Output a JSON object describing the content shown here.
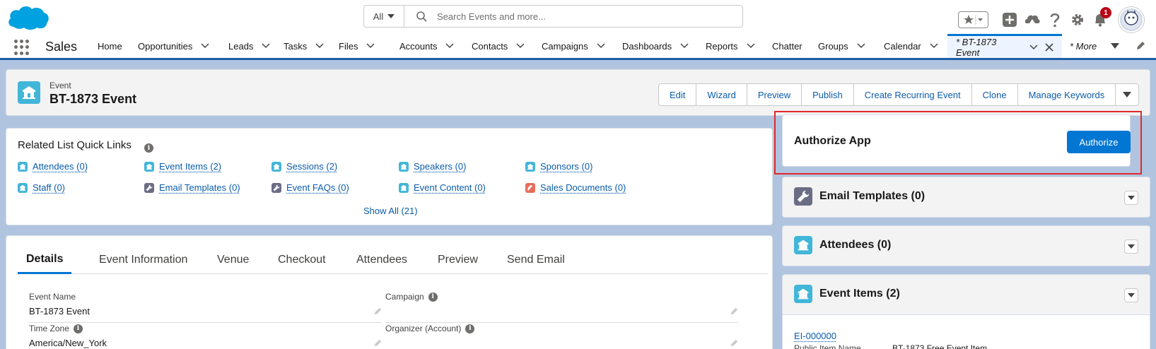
{
  "header": {
    "search_scope": "All",
    "search_placeholder": "Search Events and more...",
    "notification_count": "1",
    "colors": {
      "brand": "#00a1e0",
      "accent": "#0176d3"
    }
  },
  "nav": {
    "app_name": "Sales",
    "items": [
      {
        "label": "Home",
        "dropdown": false
      },
      {
        "label": "Opportunities",
        "dropdown": true
      },
      {
        "label": "Leads",
        "dropdown": true
      },
      {
        "label": "Tasks",
        "dropdown": true
      },
      {
        "label": "Files",
        "dropdown": true
      },
      {
        "label": "Accounts",
        "dropdown": true
      },
      {
        "label": "Contacts",
        "dropdown": true
      },
      {
        "label": "Campaigns",
        "dropdown": true
      },
      {
        "label": "Dashboards",
        "dropdown": true
      },
      {
        "label": "Reports",
        "dropdown": true
      },
      {
        "label": "Chatter",
        "dropdown": false
      },
      {
        "label": "Groups",
        "dropdown": true
      },
      {
        "label": "Calendar",
        "dropdown": true
      }
    ],
    "active_tab": "* BT-1873 Event",
    "more": "* More"
  },
  "record": {
    "type": "Event",
    "title": "BT-1873 Event",
    "actions": [
      "Edit",
      "Wizard",
      "Preview",
      "Publish",
      "Create Recurring Event",
      "Clone",
      "Manage Keywords"
    ]
  },
  "quick_links": {
    "title": "Related List Quick Links",
    "links": [
      {
        "label": "Attendees (0)",
        "icon": "event-icon",
        "color": "#42b6d8"
      },
      {
        "label": "Event Items (2)",
        "icon": "event-icon",
        "color": "#42b6d8"
      },
      {
        "label": "Sessions (2)",
        "icon": "event-icon",
        "color": "#42b6d8"
      },
      {
        "label": "Speakers (0)",
        "icon": "event-icon",
        "color": "#42b6d8"
      },
      {
        "label": "Sponsors (0)",
        "icon": "event-icon",
        "color": "#42b6d8"
      },
      {
        "label": "Staff (0)",
        "icon": "event-icon",
        "color": "#42b6d8"
      },
      {
        "label": "Email Templates (0)",
        "icon": "wrench-icon",
        "color": "#6b6d85"
      },
      {
        "label": "Event FAQs (0)",
        "icon": "wrench-icon",
        "color": "#6b6d85"
      },
      {
        "label": "Event Content (0)",
        "icon": "event-icon",
        "color": "#42b6d8"
      },
      {
        "label": "Sales Documents (0)",
        "icon": "document-icon",
        "color": "#e76d5a"
      }
    ],
    "show_all": "Show All (21)"
  },
  "details": {
    "tabs": [
      "Details",
      "Event Information",
      "Venue",
      "Checkout",
      "Attendees",
      "Preview",
      "Send Email"
    ],
    "active_tab": "Details",
    "fields": [
      {
        "label": "Event Name",
        "value": "BT-1873 Event",
        "info": false
      },
      {
        "label": "Campaign",
        "value": "",
        "info": true
      },
      {
        "label": "Time Zone",
        "value": "America/New_York",
        "info": true
      },
      {
        "label": "Organizer (Account)",
        "value": "",
        "info": true
      }
    ]
  },
  "sidebar": {
    "authorize": {
      "title": "Authorize App",
      "button": "Authorize"
    },
    "related": [
      {
        "title": "Email Templates (0)",
        "icon": "wrench-icon",
        "color": "#6b6d85"
      },
      {
        "title": "Attendees (0)",
        "icon": "event-icon",
        "color": "#42b6d8"
      },
      {
        "title": "Event Items (2)",
        "icon": "event-icon",
        "color": "#42b6d8"
      }
    ],
    "event_item": {
      "link": "EI-000000",
      "label": "Public Item Name",
      "value": "BT-1873 Free Event Item"
    }
  }
}
